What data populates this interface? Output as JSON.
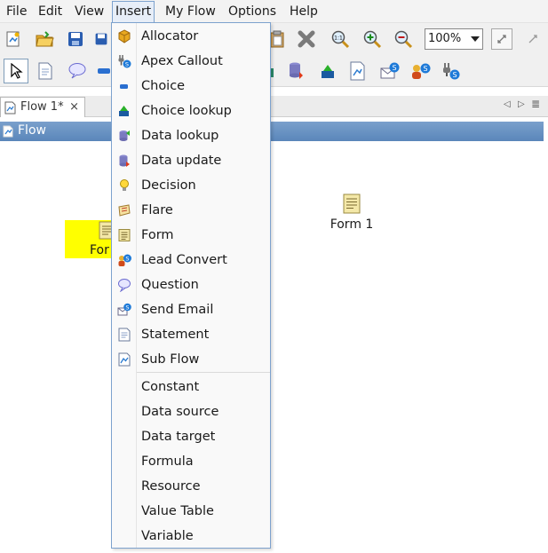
{
  "menubar": {
    "items": [
      {
        "label": "File"
      },
      {
        "label": "Edit"
      },
      {
        "label": "View"
      },
      {
        "label": "Insert"
      },
      {
        "label": "My Flow"
      },
      {
        "label": "Options"
      },
      {
        "label": "Help"
      }
    ]
  },
  "toolbar": {
    "zoom_value": "100%"
  },
  "tab": {
    "label": "Flow 1*",
    "close": "×"
  },
  "panel": {
    "title": "Flow"
  },
  "canvas": {
    "nodes": [
      {
        "label": "For"
      },
      {
        "label": "Form 1"
      }
    ]
  },
  "insert_menu": {
    "items": [
      {
        "label": "Allocator",
        "icon": "allocator-icon"
      },
      {
        "label": "Apex Callout",
        "icon": "apex-callout-icon"
      },
      {
        "label": "Choice",
        "icon": "choice-icon"
      },
      {
        "label": "Choice lookup",
        "icon": "choice-lookup-icon"
      },
      {
        "label": "Data lookup",
        "icon": "data-lookup-icon"
      },
      {
        "label": "Data update",
        "icon": "data-update-icon"
      },
      {
        "label": "Decision",
        "icon": "decision-icon"
      },
      {
        "label": "Flare",
        "icon": "flare-icon"
      },
      {
        "label": "Form",
        "icon": "form-icon"
      },
      {
        "label": "Lead Convert",
        "icon": "lead-convert-icon"
      },
      {
        "label": "Question",
        "icon": "question-icon"
      },
      {
        "label": "Send Email",
        "icon": "send-email-icon"
      },
      {
        "label": "Statement",
        "icon": "statement-icon"
      },
      {
        "label": "Sub Flow",
        "icon": "sub-flow-icon"
      },
      {
        "label": "Constant"
      },
      {
        "label": "Data source"
      },
      {
        "label": "Data target"
      },
      {
        "label": "Formula"
      },
      {
        "label": "Resource"
      },
      {
        "label": "Value Table"
      },
      {
        "label": "Variable"
      }
    ]
  },
  "colors": {
    "accent": "#7da2ce",
    "panel_title": "#5a86ba",
    "highlight": "#ffff00"
  }
}
